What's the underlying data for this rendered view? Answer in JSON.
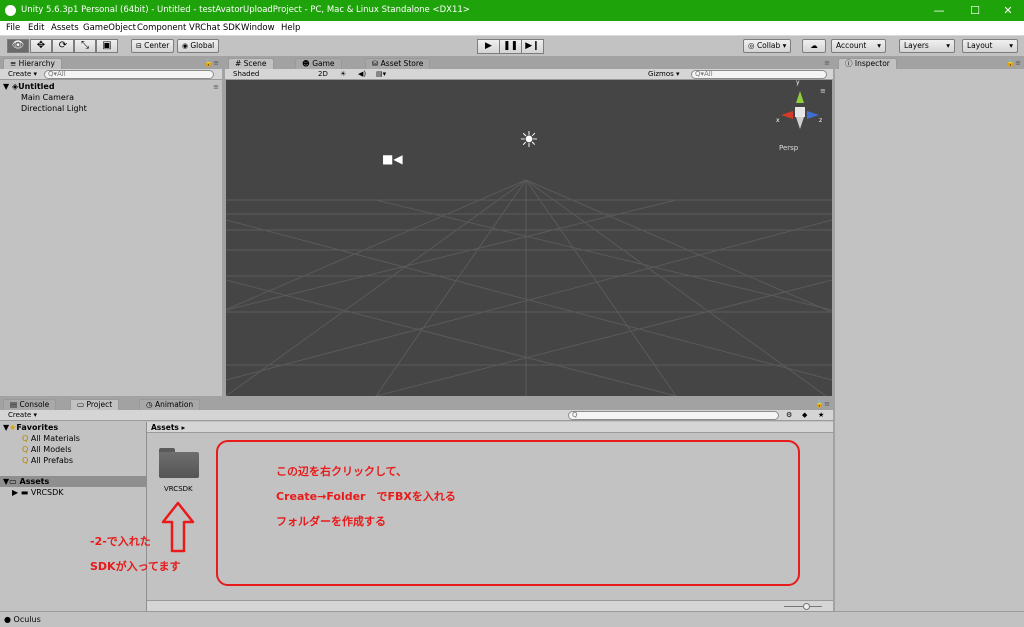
{
  "window": {
    "title": "Unity 5.6.3p1 Personal (64bit) - Untitled - testAvatorUploadProject - PC, Mac & Linux Standalone <DX11>",
    "minimize": "—",
    "maximize": "☐",
    "close": "✕"
  },
  "menu": [
    "File",
    "Edit",
    "Assets",
    "GameObject",
    "Component",
    "VRChat SDK",
    "Window",
    "Help"
  ],
  "toolbar": {
    "center": "Center",
    "global": "Global",
    "collab": "Collab ▾",
    "account": "Account",
    "layers": "Layers",
    "layout": "Layout"
  },
  "hierarchy": {
    "tab": "Hierarchy",
    "create": "Create ▾",
    "search_placeholder": "Q▾All",
    "scene": "Untitled",
    "items": [
      "Main Camera",
      "Directional Light"
    ]
  },
  "scene_view": {
    "tabs": [
      "Scene",
      "Game",
      "Asset Store"
    ],
    "shading": "Shaded",
    "mode2d": "2D",
    "gizmos": "Gizmos ▾",
    "search_placeholder": "Q▾All",
    "persp": "Persp",
    "axis_y": "y",
    "axis_x": "x",
    "axis_z": "z"
  },
  "inspector": {
    "tab": "Inspector"
  },
  "bottom": {
    "tabs": [
      "Console",
      "Project",
      "Animation"
    ],
    "create": "Create ▾"
  },
  "project": {
    "favorites_label": "Favorites",
    "favorites": [
      "All Materials",
      "All Models",
      "All Prefabs"
    ],
    "assets_label": "Assets",
    "tree_child": "VRCSDK",
    "breadcrumb": "Assets ▸",
    "folder_name": "VRCSDK"
  },
  "annotations": {
    "box_line1": "この辺を右クリックして、",
    "box_line2": "Create→Folder　でFBXを入れる",
    "box_line3": "フォルダーを作成する",
    "note_line1": "-2-で入れた",
    "note_line2": "SDKが入ってます"
  },
  "status": {
    "text": "Oculus"
  },
  "colors": {
    "titlebar": "#1fa30a",
    "annotation": "#e81a1a",
    "scene_bg": "#454545",
    "panel": "#c2c2c2"
  }
}
